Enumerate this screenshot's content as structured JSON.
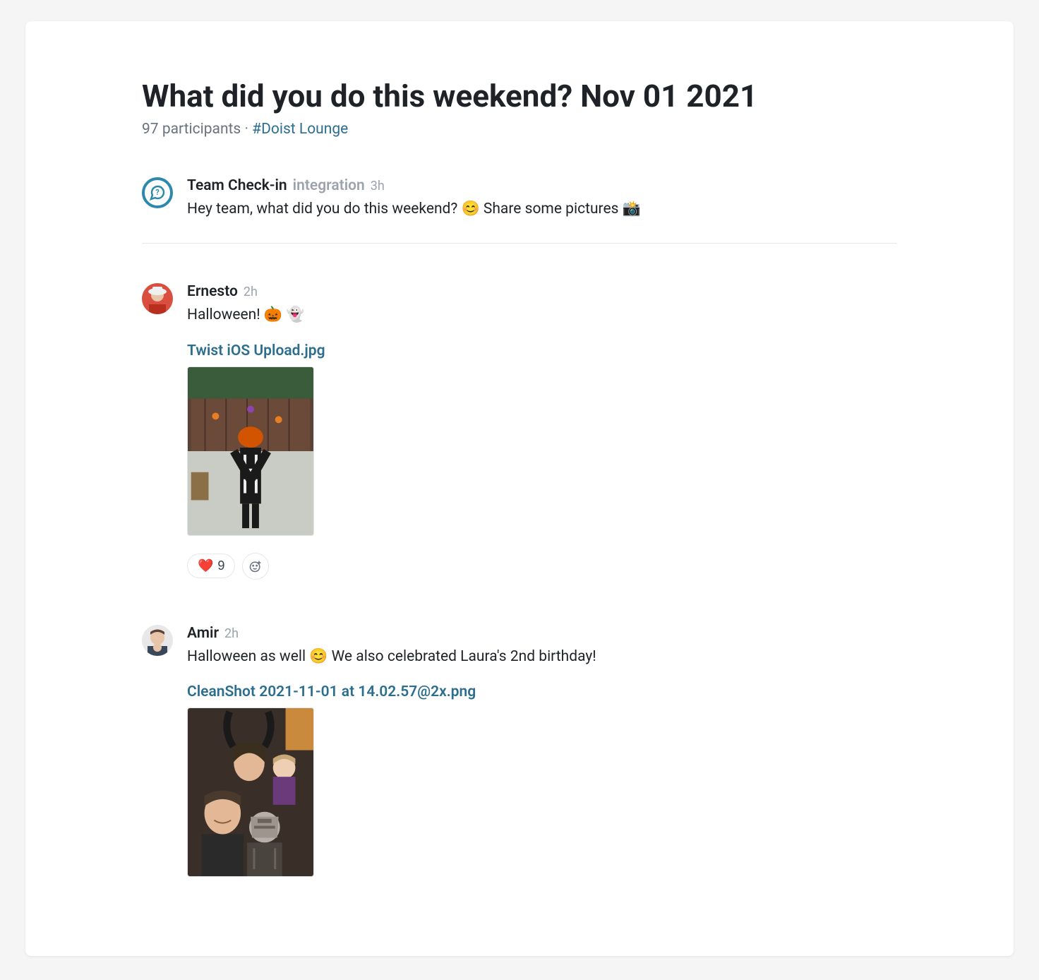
{
  "thread": {
    "title": "What did you do this weekend? Nov 01 2021",
    "participants_text": "97 participants",
    "channel_separator": " · ",
    "channel": "#Doist Lounge"
  },
  "posts": [
    {
      "author": "Team Check-in",
      "badge": "integration",
      "time": "3h",
      "text": "Hey team, what did you do this weekend? 😊 Share some pictures 📸",
      "avatar_type": "bot"
    },
    {
      "author": "Ernesto",
      "time": "2h",
      "text": "Halloween! 🎃 👻",
      "attachment_name": "Twist iOS Upload.jpg",
      "reactions": [
        {
          "emoji": "❤️",
          "count": "9"
        }
      ],
      "avatar_type": "person1"
    },
    {
      "author": "Amir",
      "time": "2h",
      "text": "Halloween as well 😊 We also celebrated Laura's 2nd birthday!",
      "attachment_name": "CleanShot 2021-11-01 at 14.02.57@2x.png",
      "avatar_type": "person2"
    }
  ]
}
